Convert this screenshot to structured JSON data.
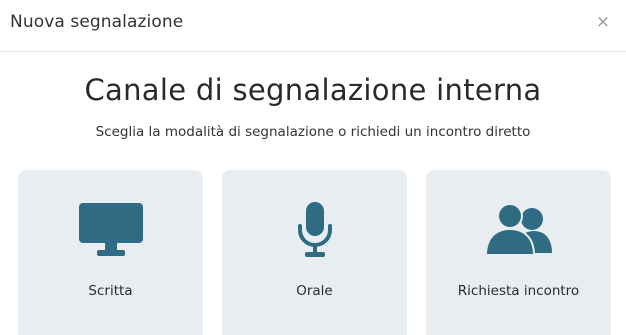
{
  "modal": {
    "title": "Nuova segnalazione",
    "close_label": "×"
  },
  "main": {
    "heading": "Canale di segnalazione interna",
    "subheading": "Sceglia la modalità di segnalazione o richiedi un incontro diretto"
  },
  "options": [
    {
      "label": "Scritta",
      "icon": "desktop-icon"
    },
    {
      "label": "Orale",
      "icon": "microphone-icon"
    },
    {
      "label": "Richiesta incontro",
      "icon": "users-icon"
    }
  ],
  "colors": {
    "icon": "#2f6b83",
    "card_bg": "#e8edf1"
  }
}
